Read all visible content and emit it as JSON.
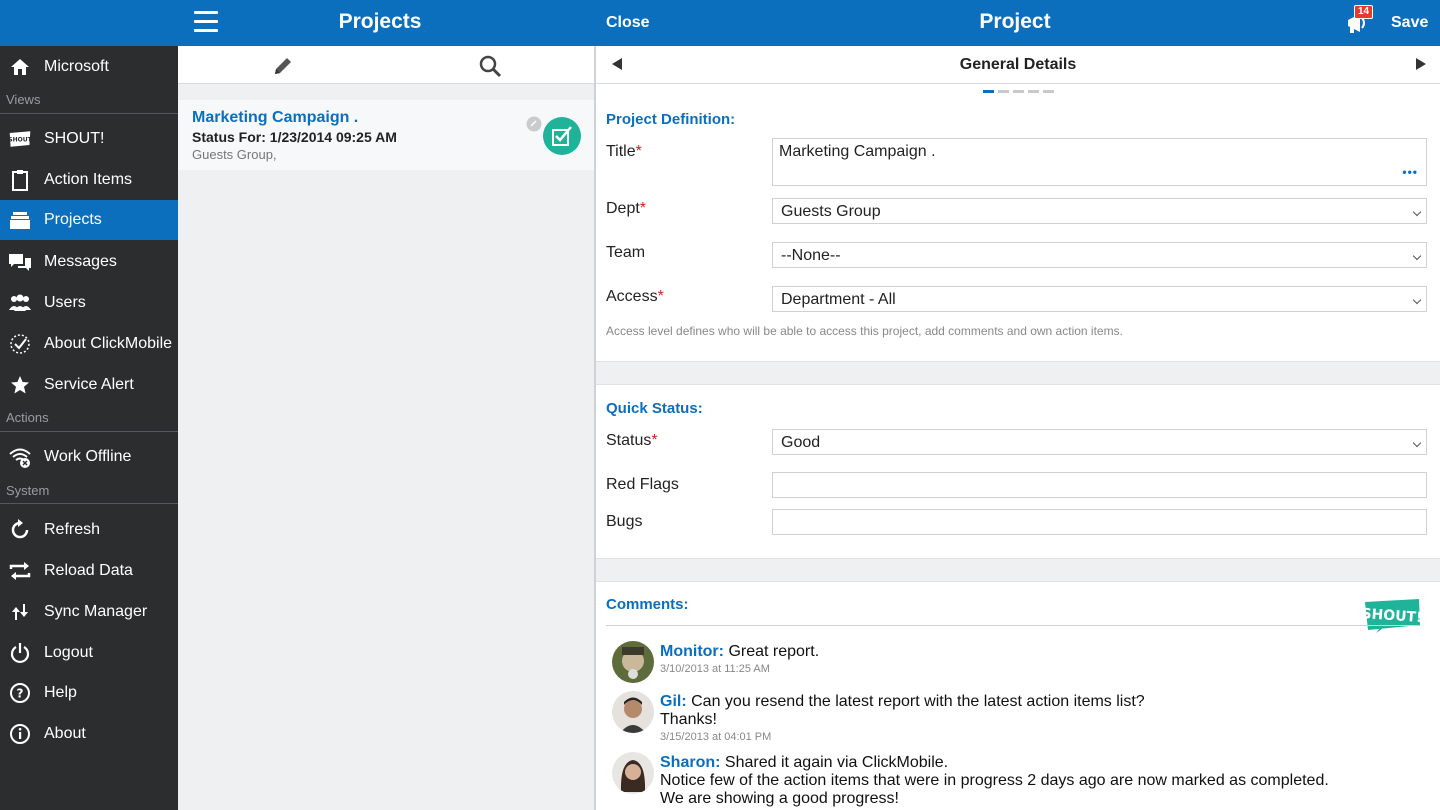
{
  "topbar": {
    "list_title": "Projects",
    "close_label": "Close",
    "detail_title": "Project",
    "notification_count": "14",
    "save_label": "Save"
  },
  "sidebar": {
    "account": "Microsoft",
    "sections": {
      "views": "Views",
      "actions": "Actions",
      "system": "System"
    },
    "views": [
      "SHOUT!",
      "Action Items",
      "Projects",
      "Messages",
      "Users",
      "About ClickMobile",
      "Service Alert"
    ],
    "actions": [
      "Work Offline"
    ],
    "system": [
      "Refresh",
      "Reload Data",
      "Sync Manager",
      "Logout",
      "Help",
      "About"
    ],
    "active": "Projects"
  },
  "list": {
    "entry": {
      "title": "Marketing Campaign .",
      "status": "Status For: 1/23/2014 09:25 AM",
      "group": "Guests Group,"
    }
  },
  "detail": {
    "page_title": "General Details",
    "pager": {
      "total": 5,
      "current": 1
    },
    "definition": {
      "heading": "Project Definition:",
      "title_label": "Title",
      "title_value": "Marketing Campaign .",
      "dept_label": "Dept",
      "dept_value": "Guests Group",
      "team_label": "Team",
      "team_value": "--None--",
      "access_label": "Access",
      "access_value": "Department - All",
      "hint": "Access level defines who will be able to access this project, add comments and own action items."
    },
    "quick_status": {
      "heading": "Quick Status:",
      "status_label": "Status",
      "status_value": "Good",
      "red_flags_label": "Red Flags",
      "red_flags_value": "",
      "bugs_label": "Bugs",
      "bugs_value": ""
    },
    "comments": {
      "heading": "Comments:",
      "items": [
        {
          "author": "Monitor:",
          "lines": [
            "Great report."
          ],
          "time": "3/10/2013 at 11:25 AM"
        },
        {
          "author": "Gil:",
          "lines": [
            "Can you resend the latest report with the latest action items list?",
            "Thanks!"
          ],
          "time": "3/15/2013 at 04:01 PM"
        },
        {
          "author": "Sharon:",
          "lines": [
            "Shared it again via ClickMobile.",
            "Notice few of the action items that were in progress 2 days ago are now marked as completed.",
            "We are showing a good progress!"
          ],
          "time": ""
        }
      ]
    }
  },
  "colors": {
    "brand": "#0b6fbd",
    "sidebar": "#2b2d2f",
    "accent_green": "#1fb39a",
    "required": "#d02020"
  }
}
